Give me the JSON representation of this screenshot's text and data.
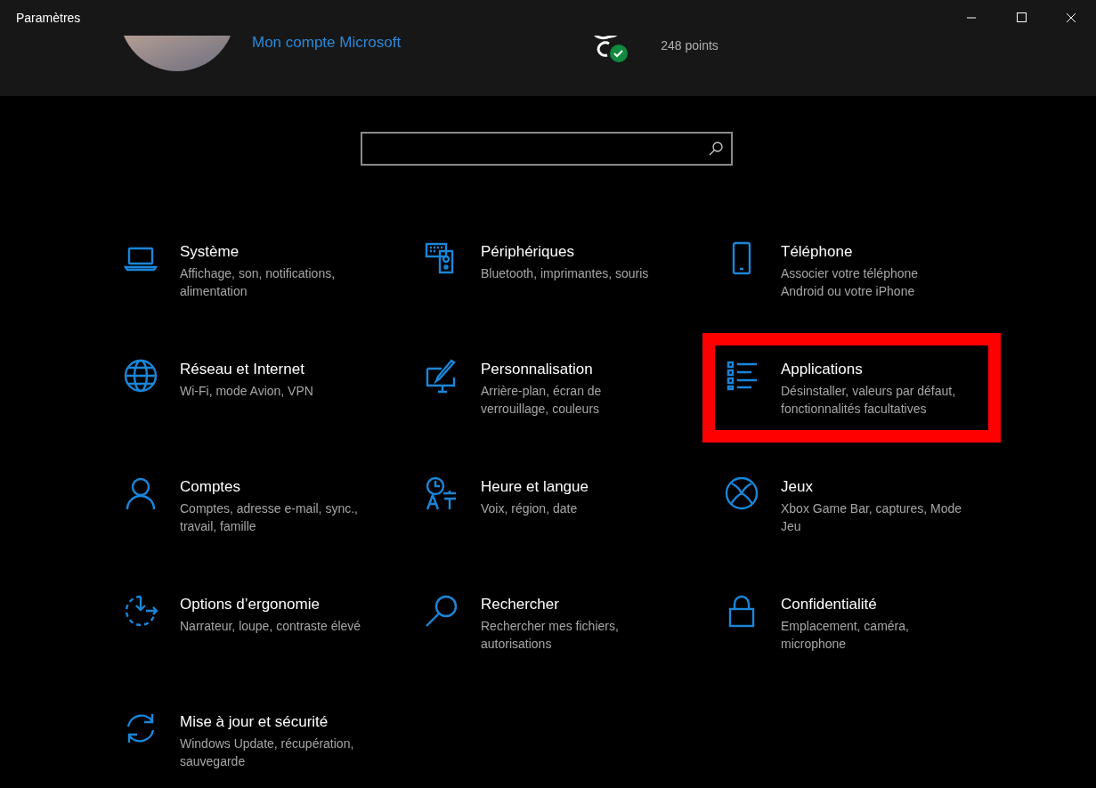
{
  "window": {
    "title": "Paramètres"
  },
  "account": {
    "link": "Mon compte Microsoft",
    "points": "248 points"
  },
  "categories": [
    {
      "kind": "system",
      "title": "Système",
      "description": "Affichage, son, notifications, alimentation",
      "highlighted": false
    },
    {
      "kind": "devices",
      "title": "Périphériques",
      "description": "Bluetooth, imprimantes, souris",
      "highlighted": false
    },
    {
      "kind": "phone",
      "title": "Téléphone",
      "description": "Associer votre téléphone Android ou votre iPhone",
      "highlighted": false
    },
    {
      "kind": "network",
      "title": "Réseau et Internet",
      "description": "Wi-Fi, mode Avion, VPN",
      "highlighted": false
    },
    {
      "kind": "personalization",
      "title": "Personnalisation",
      "description": "Arrière-plan, écran de verrouillage, couleurs",
      "highlighted": false
    },
    {
      "kind": "apps",
      "title": "Applications",
      "description": "Désinstaller, valeurs par défaut, fonctionnalités facultatives",
      "highlighted": true
    },
    {
      "kind": "accounts",
      "title": "Comptes",
      "description": "Comptes, adresse e-mail, sync., travail, famille",
      "highlighted": false
    },
    {
      "kind": "time",
      "title": "Heure et langue",
      "description": "Voix, région, date",
      "highlighted": false
    },
    {
      "kind": "gaming",
      "title": "Jeux",
      "description": "Xbox Game Bar, captures, Mode Jeu",
      "highlighted": false
    },
    {
      "kind": "ease",
      "title": "Options d’ergonomie",
      "description": "Narrateur, loupe, contraste élevé",
      "highlighted": false
    },
    {
      "kind": "search",
      "title": "Rechercher",
      "description": "Rechercher mes fichiers, autorisations",
      "highlighted": false
    },
    {
      "kind": "privacy",
      "title": "Confidentialité",
      "description": "Emplacement, caméra, microphone",
      "highlighted": false
    },
    {
      "kind": "update",
      "title": "Mise à jour et sécurité",
      "description": "Windows Update, récupération, sauvegarde",
      "highlighted": false
    }
  ]
}
